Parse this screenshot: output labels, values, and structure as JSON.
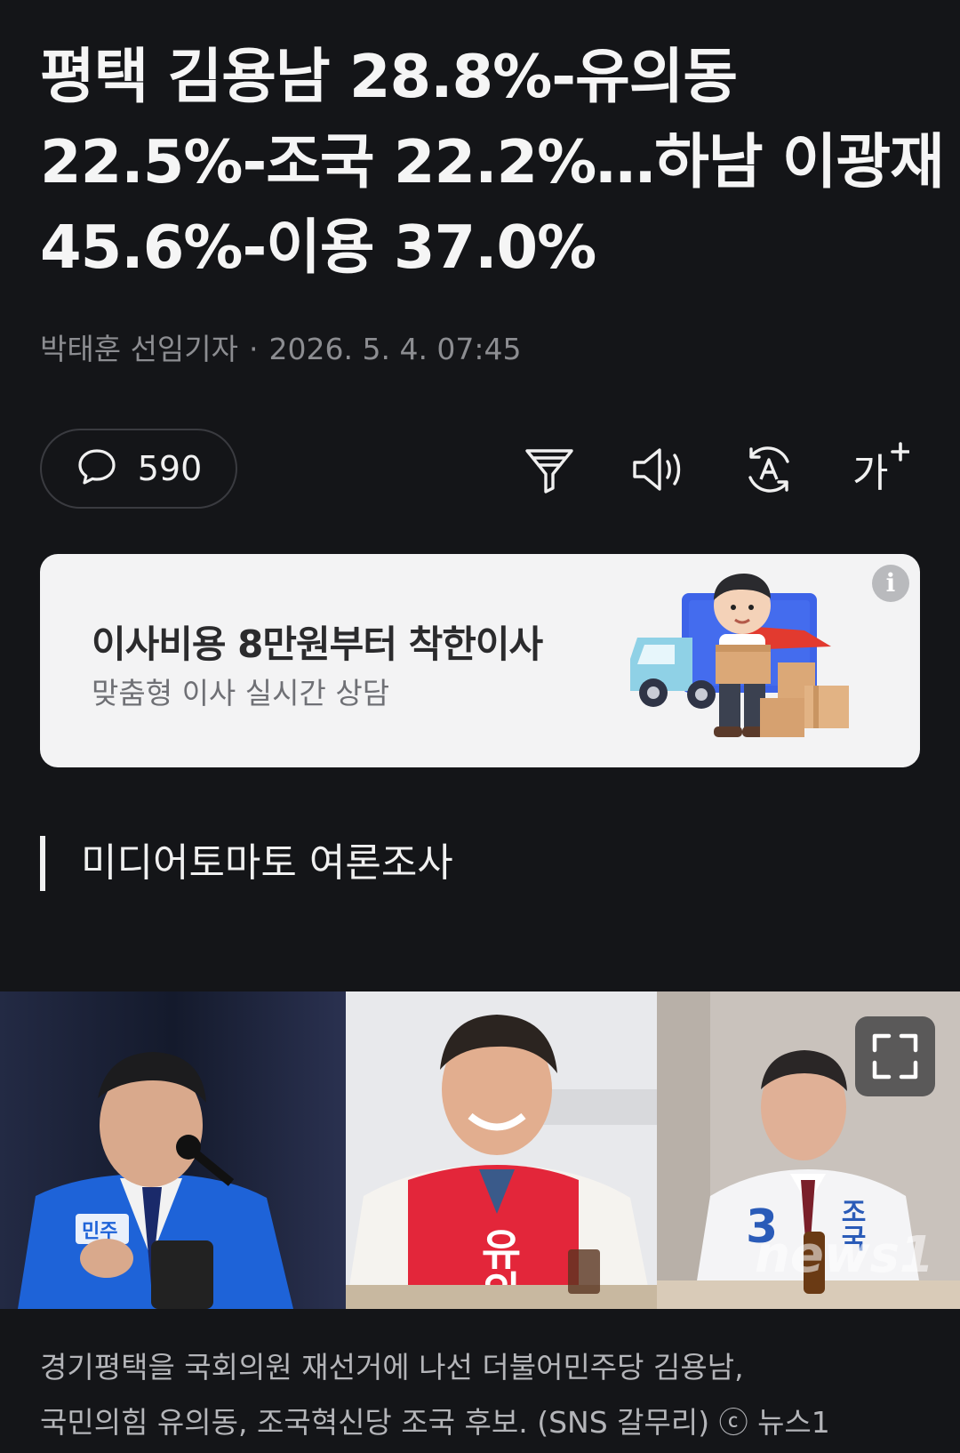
{
  "article": {
    "headline_lines": [
      "평택 김용남 28.8%-유의동",
      "22.5%-조국 22.2%…하남 이광재",
      "45.6%-이용 37.0%"
    ],
    "author": "박태훈 선임기자",
    "separator": "·",
    "datetime": "2026. 5. 4. 07:45"
  },
  "toolbar": {
    "comment_count": "590",
    "icons": [
      "comment-icon",
      "filter-icon",
      "speaker-icon",
      "translate-icon",
      "font-size-icon"
    ],
    "font_size_label": "가"
  },
  "ad": {
    "title": "이사비용 8만원부터 착한이사",
    "subtitle": "맞춤형 이사 실시간 상담",
    "info_glyph": "i"
  },
  "section": {
    "title": "미디어토마토 여론조사"
  },
  "photo": {
    "panels": [
      {
        "candidate": "김용남",
        "party_color": "#1e63d8"
      },
      {
        "candidate": "유의동",
        "party_color": "#e3263a"
      },
      {
        "candidate": "조국",
        "party_color": "#2a5bb8"
      }
    ],
    "sash_texts": [
      "민주",
      "유의동",
      "조국",
      "3"
    ],
    "watermark": "news1"
  },
  "caption": {
    "lines": [
      "경기평택을 국회의원 재선거에 나선 더불어민주당 김용남,",
      "국민의힘 유의동, 조국혁신당 조국 후보. (SNS 갈무리) ⓒ 뉴스1"
    ]
  },
  "colors": {
    "background": "#141518",
    "text_primary": "#f5f5f5",
    "text_muted": "#8c8d91",
    "ad_background": "#f3f3f4"
  }
}
